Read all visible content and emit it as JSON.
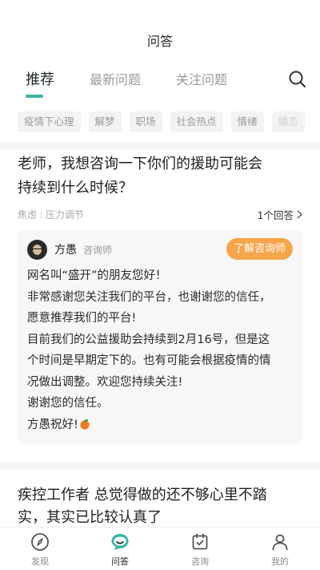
{
  "header": {
    "title": "问答"
  },
  "tabs": [
    {
      "label": "推荐",
      "active": true
    },
    {
      "label": "最新问题",
      "active": false
    },
    {
      "label": "关注问题",
      "active": false
    }
  ],
  "chips": [
    "疫情下心理",
    "解梦",
    "职场",
    "社会热点",
    "情绪",
    "婚恋"
  ],
  "question1": {
    "title_line1": "老师，我想咨询一下你们的援助可能会",
    "title_line2": "持续到什么时候？",
    "tag1": "焦虑",
    "tag2": "压力调节",
    "answer_count": "1个回答",
    "answer": {
      "name": "方愚",
      "role": "咨询师",
      "cta": "了解咨询师",
      "lines": [
        "网名叫“盛开”的朋友您好！",
        "非常感谢您关注我们的平台，也谢谢您的信任，",
        "愿意推荐我们的平台!",
        "目前我们的公益援助会持续到2月16号，但是这",
        "个时间是早期定下的。也有可能会根据疫情的情",
        "况做出调整。欢迎您持续关注!",
        "谢谢您的信任。",
        "方愚祝好!"
      ]
    }
  },
  "question2": {
    "title_line1": "疾控工作者 总觉得做的还不够心里不踏",
    "title_line2": "实，其实已比较认真了"
  },
  "bottom_nav": [
    {
      "label": "发现",
      "icon": "compass-icon",
      "active": false
    },
    {
      "label": "问答",
      "icon": "chat-bubble-icon",
      "active": true
    },
    {
      "label": "咨询",
      "icon": "calendar-check-icon",
      "active": false
    },
    {
      "label": "我的",
      "icon": "person-icon",
      "active": false
    }
  ],
  "colors": {
    "accent": "#3cb5a6",
    "cta": "#f5a54a"
  }
}
